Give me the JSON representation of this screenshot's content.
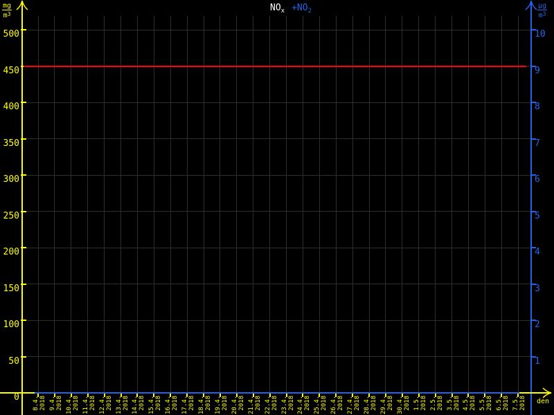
{
  "title": {
    "series1": "NO",
    "series1_sub": "x",
    "series2": "+NO",
    "series2_sub": "2"
  },
  "left_axis": {
    "unit_numerator": "mg",
    "unit_denominator_base": "m",
    "unit_denominator_exp": "3",
    "tick_labels": [
      "0",
      "50",
      "100",
      "150",
      "200",
      "250",
      "300",
      "350",
      "400",
      "450",
      "500"
    ]
  },
  "right_axis": {
    "unit_numerator": "µg",
    "unit_denominator_base": "m",
    "unit_denominator_exp": "3",
    "tick_labels": [
      "1",
      "2",
      "3",
      "4",
      "5",
      "6",
      "7",
      "8",
      "9",
      "10"
    ]
  },
  "x_axis": {
    "arrow_label": "den",
    "year": "2018",
    "dates": [
      "8.4.",
      "9.4.",
      "10.4.",
      "11.4.",
      "12.4.",
      "13.4.",
      "14.4.",
      "15.4.",
      "16.4.",
      "17.4.",
      "18.4.",
      "19.4.",
      "20.4.",
      "21.4.",
      "22.4.",
      "23.4.",
      "24.4.",
      "25.4.",
      "26.4.",
      "27.4.",
      "28.4.",
      "29.4.",
      "30.4.",
      "1.5.",
      "2.5.",
      "3.5.",
      "4.5.",
      "5.5.",
      "6.5.",
      "7.5."
    ]
  },
  "colors": {
    "background": "#000000",
    "axis_left": "#ffff00",
    "axis_right": "#2364eb",
    "grid": "#2e2e2e",
    "series_nox": "#ff0000",
    "series_no2": "#2364eb",
    "title_primary": "#ffffff"
  },
  "chart_data": {
    "type": "line",
    "title": "NOx +NO2",
    "x_labels": [
      "8.4.2018",
      "9.4.2018",
      "10.4.2018",
      "11.4.2018",
      "12.4.2018",
      "13.4.2018",
      "14.4.2018",
      "15.4.2018",
      "16.4.2018",
      "17.4.2018",
      "18.4.2018",
      "19.4.2018",
      "20.4.2018",
      "21.4.2018",
      "22.4.2018",
      "23.4.2018",
      "24.4.2018",
      "25.4.2018",
      "26.4.2018",
      "27.4.2018",
      "28.4.2018",
      "29.4.2018",
      "30.4.2018",
      "1.5.2018",
      "2.5.2018",
      "3.5.2018",
      "4.5.2018",
      "5.5.2018",
      "6.5.2018",
      "7.5.2018"
    ],
    "xlabel": "den",
    "left_axis": {
      "label": "mg/m3",
      "range": [
        0,
        530
      ],
      "ticks": [
        0,
        50,
        100,
        150,
        200,
        250,
        300,
        350,
        400,
        450,
        500
      ]
    },
    "right_axis": {
      "label": "µg/m3",
      "range": [
        0,
        10.6
      ],
      "ticks": [
        1,
        2,
        3,
        4,
        5,
        6,
        7,
        8,
        9,
        10
      ]
    },
    "grid": true,
    "legend_position": "top-center",
    "series": [
      {
        "name": "NOx",
        "color": "#ff0000",
        "axis": "left",
        "style": "constant-line",
        "value": 450
      },
      {
        "name": "NO2",
        "color": "#2364eb",
        "axis": "right",
        "style": "constant-line",
        "value": 0
      }
    ]
  }
}
